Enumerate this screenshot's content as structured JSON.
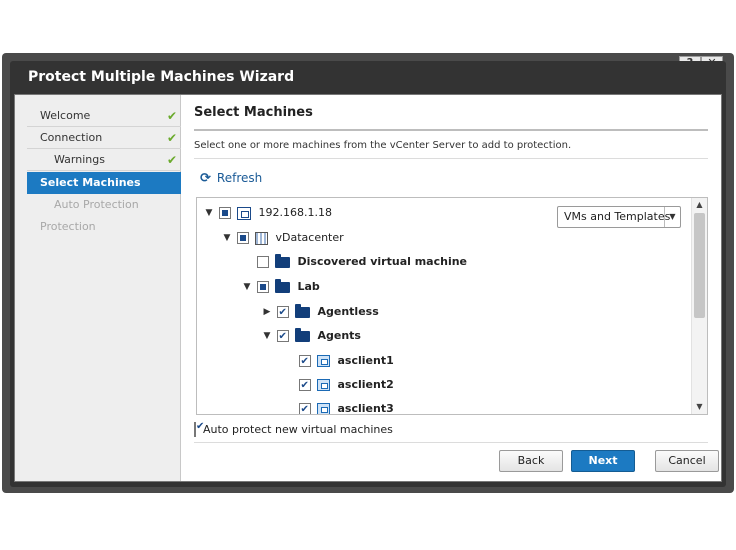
{
  "window": {
    "title": "Protect Multiple Machines Wizard",
    "help_label": "?",
    "close_label": "✕"
  },
  "nav": {
    "items": [
      {
        "label": "Welcome",
        "state": "done"
      },
      {
        "label": "Connection",
        "state": "done"
      },
      {
        "label": "Warnings",
        "state": "done"
      },
      {
        "label": "Select Machines",
        "state": "active"
      },
      {
        "label": "Auto Protection",
        "state": "disabled"
      },
      {
        "label": "Protection",
        "state": "disabled"
      }
    ],
    "check_mark": "✔"
  },
  "main": {
    "heading": "Select Machines",
    "description": "Select one or more machines from the vCenter Server to add to protection.",
    "refresh_label": "Refresh",
    "refresh_icon": "⟳"
  },
  "filter": {
    "selected": "VMs and Templates",
    "arrow": "▼"
  },
  "tree": {
    "nodes": [
      {
        "label": "192.168.1.18",
        "icon": "host-icon",
        "expander": "▼",
        "check": "partial"
      },
      {
        "label": "vDatacenter",
        "icon": "datacenter-icon",
        "expander": "▼",
        "check": "partial"
      },
      {
        "label": "Discovered virtual machine",
        "icon": "folder-icon",
        "expander": "",
        "check": "unchecked"
      },
      {
        "label": "Lab",
        "icon": "folder-icon",
        "expander": "▼",
        "check": "partial"
      },
      {
        "label": "Agentless",
        "icon": "folder-icon",
        "expander": "▶",
        "check": "checked"
      },
      {
        "label": "Agents",
        "icon": "folder-icon",
        "expander": "▼",
        "check": "checked"
      },
      {
        "label": "asclient1",
        "icon": "vm-icon",
        "expander": "",
        "check": "checked"
      },
      {
        "label": "asclient2",
        "icon": "vm-icon",
        "expander": "",
        "check": "checked"
      },
      {
        "label": "asclient3",
        "icon": "vm-icon",
        "expander": "",
        "check": "checked"
      }
    ]
  },
  "scrollbar": {
    "up": "▲",
    "down": "▼"
  },
  "auto_protect": {
    "label": "Auto protect new virtual machines",
    "checked": true
  },
  "buttons": {
    "back": "Back",
    "next": "Next",
    "cancel": "Cancel"
  },
  "colors": {
    "accent": "#1c7ac2",
    "check_green": "#6aaa2c",
    "frame": "#4a4a4a"
  }
}
